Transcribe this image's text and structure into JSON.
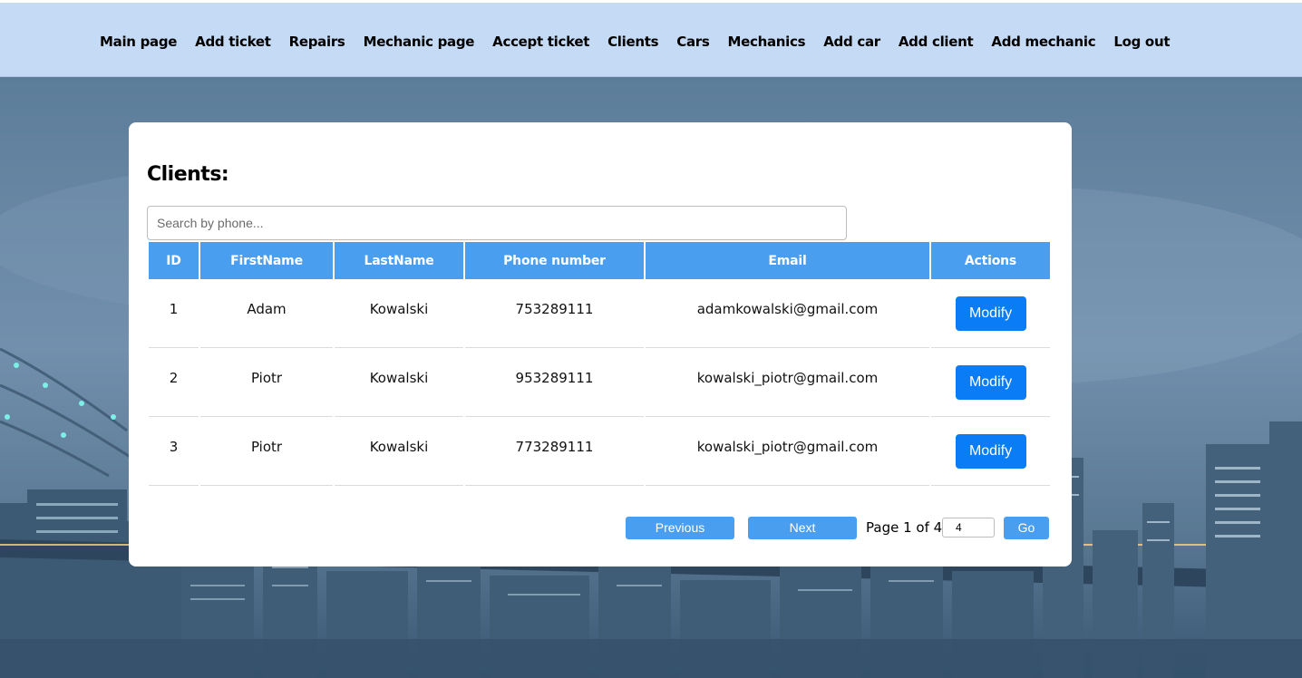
{
  "nav": {
    "items": [
      {
        "label": "Main page"
      },
      {
        "label": "Add ticket"
      },
      {
        "label": "Repairs"
      },
      {
        "label": "Mechanic page"
      },
      {
        "label": "Accept ticket"
      },
      {
        "label": "Clients"
      },
      {
        "label": "Cars"
      },
      {
        "label": "Mechanics"
      },
      {
        "label": "Add car"
      },
      {
        "label": "Add client"
      },
      {
        "label": "Add mechanic"
      },
      {
        "label": "Log out"
      }
    ]
  },
  "card": {
    "title": "Clients:",
    "search": {
      "placeholder": "Search by phone...",
      "value": ""
    }
  },
  "table": {
    "headers": [
      "ID",
      "FirstName",
      "LastName",
      "Phone number",
      "Email",
      "Actions"
    ],
    "rows": [
      {
        "id": "1",
        "first": "Adam",
        "last": "Kowalski",
        "phone": "753289111",
        "email": "adamkowalski@gmail.com",
        "action": "Modify"
      },
      {
        "id": "2",
        "first": "Piotr",
        "last": "Kowalski",
        "phone": "953289111",
        "email": "kowalski_piotr@gmail.com",
        "action": "Modify"
      },
      {
        "id": "3",
        "first": "Piotr",
        "last": "Kowalski",
        "phone": "773289111",
        "email": "kowalski_piotr@gmail.com",
        "action": "Modify"
      }
    ]
  },
  "pagination": {
    "previous_label": "Previous",
    "next_label": "Next",
    "page_text": "Page 1 of 4",
    "page_input_value": "4",
    "go_label": "Go"
  },
  "colors": {
    "navbar": "#c4daf5",
    "table_header": "#4a9eef",
    "button": "#0a7cf5"
  }
}
